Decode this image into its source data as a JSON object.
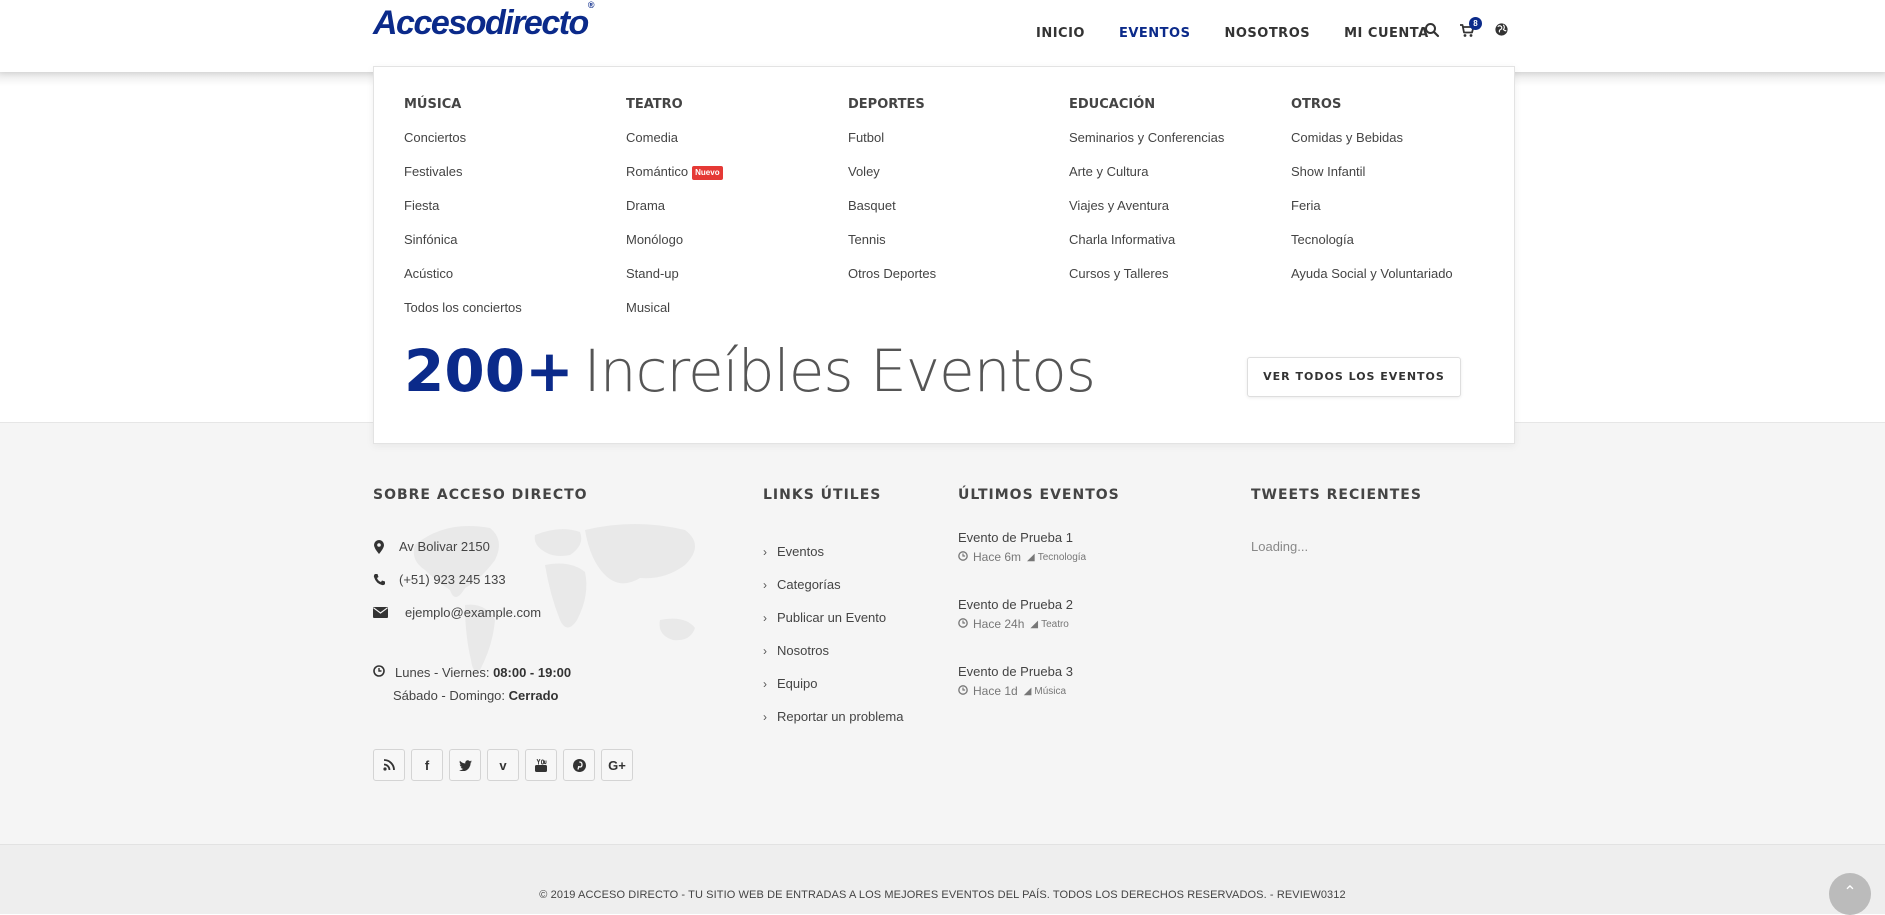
{
  "header": {
    "logo_text": "Accesodirecto",
    "logo_mark": "®",
    "nav": [
      "INICIO",
      "EVENTOS",
      "NOSOTROS",
      "MI CUENTA"
    ],
    "active_nav": "EVENTOS",
    "cart_count": "8",
    "icons": [
      "search-icon",
      "cart-icon",
      "globe-icon"
    ]
  },
  "mega_menu": {
    "columns": [
      {
        "title": "MÚSICA",
        "items": [
          "Conciertos",
          "Festivales",
          "Fiesta",
          "Sinfónica",
          "Acústico",
          "Todos los conciertos"
        ]
      },
      {
        "title": "TEATRO",
        "items": [
          "Comedia",
          "Romántico",
          "Drama",
          "Monólogo",
          "Stand-up",
          "Musical"
        ],
        "badge_item": "Romántico",
        "badge": "Nuevo"
      },
      {
        "title": "DEPORTES",
        "items": [
          "Futbol",
          "Voley",
          "Basquet",
          "Tennis",
          "Otros Deportes"
        ]
      },
      {
        "title": "EDUCACIÓN",
        "items": [
          "Seminarios y Conferencias",
          "Arte y Cultura",
          "Viajes y Aventura",
          "Charla Informativa",
          "Cursos y Talleres"
        ]
      },
      {
        "title": "OTROS",
        "items": [
          "Comidas y Bebidas",
          "Show Infantil",
          "Feria",
          "Tecnología",
          "Ayuda Social y Voluntariado"
        ]
      }
    ],
    "promo_number": "200+",
    "promo_text": "Increíbles Eventos",
    "cta_label": "VER TODOS LOS EVENTOS"
  },
  "footer": {
    "about_title": "SOBRE ACCESO DIRECTO",
    "address": "Av Bolivar 2150",
    "phone": "(+51) 923 245 133",
    "email": "ejemplo@example.com",
    "hours_weekday_label": "Lunes - Viernes:",
    "hours_weekday_value": "08:00 - 19:00",
    "hours_weekend_label": "Sábado - Domingo:",
    "hours_weekend_value": "Cerrado",
    "social": [
      "rss-icon",
      "facebook-icon",
      "twitter-icon",
      "vimeo-icon",
      "youtube-icon",
      "pinterest-icon",
      "google-plus-icon"
    ],
    "links_title": "LINKS ÚTILES",
    "links": [
      "Eventos",
      "Categorías",
      "Publicar un Evento",
      "Nosotros",
      "Equipo",
      "Reportar un problema"
    ],
    "events_title": "ÚLTIMOS EVENTOS",
    "events": [
      {
        "title": "Evento de Prueba 1",
        "time": "Hace 6m",
        "tag": "Tecnología"
      },
      {
        "title": "Evento de Prueba 2",
        "time": "Hace 24h",
        "tag": "Teatro"
      },
      {
        "title": "Evento de Prueba 3",
        "time": "Hace 1d",
        "tag": "Música"
      }
    ],
    "tweets_title": "TWEETS RECIENTES",
    "tweets_status": "Loading...",
    "copyright": "© 2019 ACCESO DIRECTO - TU SITIO WEB DE ENTRADAS A LOS MEJORES EVENTOS DEL PAÍS. TODOS LOS DERECHOS RESERVADOS. - REVIEW0312"
  },
  "colors": {
    "brand": "#0b2a8a",
    "badge": "#e53935",
    "footer_bg": "#f5f5f5"
  }
}
